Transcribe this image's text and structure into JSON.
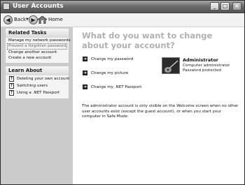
{
  "window": {
    "title": "User Accounts"
  },
  "toolbar": {
    "back_label": "Back",
    "home_label": "Home"
  },
  "sidebar": {
    "related_tasks": {
      "header": "Related Tasks",
      "items": [
        "Manage my network passwords",
        "Prevent a forgotten password",
        "Change another account",
        "Create a new account"
      ]
    },
    "learn_about": {
      "header": "Learn About",
      "items": [
        "Deleting your own account",
        "Switching users",
        "Using a .NET Passport"
      ]
    }
  },
  "main": {
    "heading": "What do you want to change about your account?",
    "tasks": [
      "Change my password",
      "Change my picture",
      "Change my .NET Passport"
    ],
    "account": {
      "name": "Administrator",
      "type": "Computer administrator",
      "status": "Password protected"
    },
    "note": "The administrator account is only visible on the Welcome screen when no other user accounts exist (except the guest account), or when you start your computer in Safe Mode."
  },
  "colors": {
    "sidebar_bg": "#cbcbcb",
    "heading": "#b0b0b0",
    "titlebar": "#6d6d6d"
  }
}
